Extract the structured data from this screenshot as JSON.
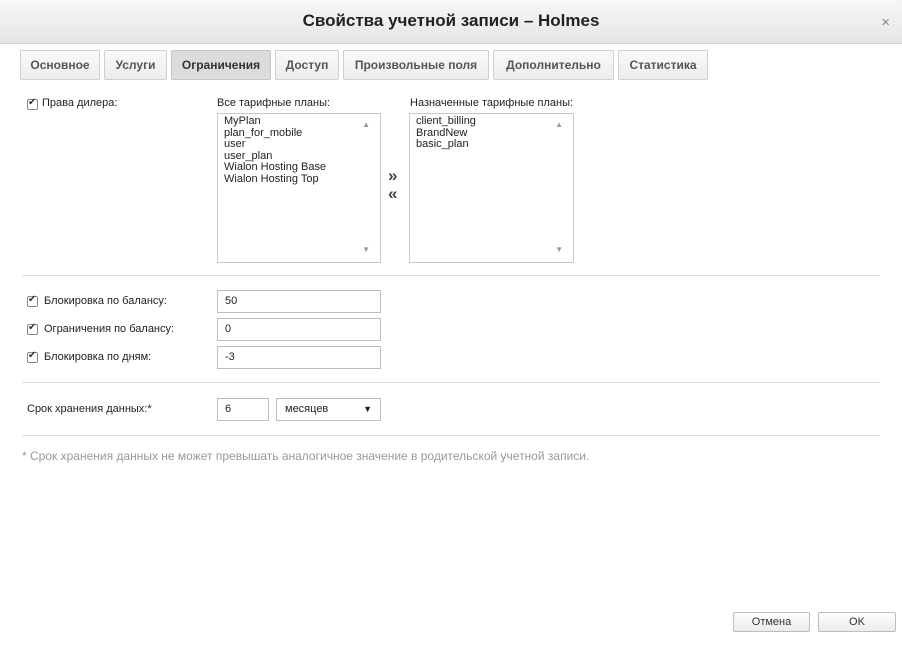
{
  "dialog": {
    "title": "Свойства учетной записи – Holmes",
    "close_glyph": "×"
  },
  "tabs": [
    {
      "label": "Основное"
    },
    {
      "label": "Услуги"
    },
    {
      "label": "Ограничения",
      "active": true
    },
    {
      "label": "Доступ"
    },
    {
      "label": "Произвольные поля"
    },
    {
      "label": "Дополнительно"
    },
    {
      "label": "Статистика"
    }
  ],
  "dealer": {
    "checkbox_label": "Права дилера:",
    "checked": true,
    "all_plans_label": "Все тарифные планы:",
    "all_plans": [
      "MyPlan",
      "plan_for_mobile",
      "user",
      "user_plan",
      "Wialon Hosting Base",
      "Wialon Hosting Top"
    ],
    "assigned_plans_label": "Назначенные тарифные планы:",
    "assigned_plans": [
      "client_billing",
      "BrandNew",
      "basic_plan"
    ],
    "move_right": "»",
    "move_left": "«"
  },
  "limits": {
    "balance_block_label": "Блокировка по балансу:",
    "balance_block_value": "50",
    "balance_limit_label": "Ограничения по балансу:",
    "balance_limit_value": "0",
    "days_block_label": "Блокировка по дням:",
    "days_block_value": "-3"
  },
  "storage": {
    "label": "Срок хранения данных:*",
    "value": "6",
    "unit": "месяцев"
  },
  "note": "* Срок хранения данных не может превышать аналогичное значение в родительской учетной записи.",
  "buttons": {
    "cancel": "Отмена",
    "ok": "OK"
  }
}
